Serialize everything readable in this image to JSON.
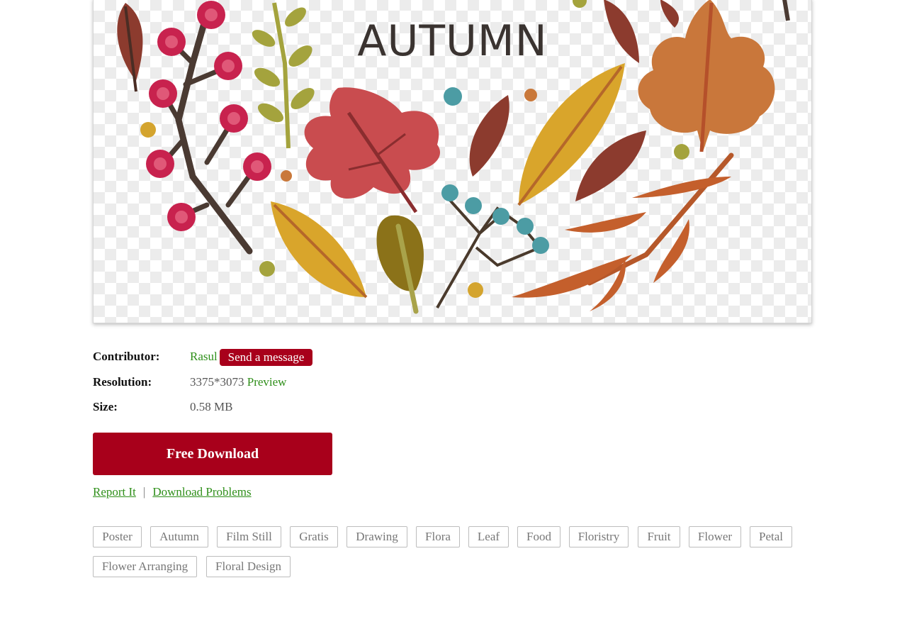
{
  "preview": {
    "title_text": "AUTUMN"
  },
  "details": {
    "contributor_label": "Contributor:",
    "contributor_name": "Rasul",
    "send_message_label": "Send a message",
    "resolution_label": "Resolution:",
    "resolution_value": "3375*3073",
    "preview_link": "Preview",
    "size_label": "Size:",
    "size_value": "0.58 MB"
  },
  "download_button": "Free Download",
  "links": {
    "report": "Report It",
    "separator": "|",
    "problems": "Download Problems"
  },
  "tags": [
    "Poster",
    "Autumn",
    "Film Still",
    "Gratis",
    "Drawing",
    "Flora",
    "Leaf",
    "Food",
    "Floristry",
    "Fruit",
    "Flower",
    "Petal",
    "Flower Arranging",
    "Floral Design"
  ],
  "colors": {
    "accent_red": "#a8001b",
    "link_green": "#2f8f1a"
  }
}
